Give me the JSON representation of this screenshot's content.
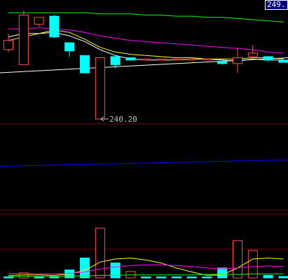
{
  "price_badge": "249.",
  "chart_data": [
    {
      "type": "candlestick",
      "panel": "main",
      "low_marker_label": "240.20",
      "colors": {
        "up": "#ff5050",
        "down": "#00ffff",
        "ma5": "#ffffff",
        "ma10": "#ffff00",
        "ma20": "#ff00ff",
        "ma60": "#00ff00",
        "trend": "#ffffff"
      },
      "candles": [
        {
          "open": 246.2,
          "close": 247.0,
          "high": 247.6,
          "low": 246.0
        },
        {
          "open": 244.9,
          "close": 249.2,
          "high": 249.6,
          "low": 244.9
        },
        {
          "open": 248.4,
          "close": 249.0,
          "high": 249.0,
          "low": 248.2
        },
        {
          "open": 249.1,
          "close": 247.3,
          "high": 249.2,
          "low": 247.2
        },
        {
          "open": 246.8,
          "close": 246.1,
          "high": 246.6,
          "low": 245.6
        },
        {
          "open": 245.7,
          "close": 244.2,
          "high": 245.7,
          "low": 244.2
        },
        {
          "open": 240.2,
          "close": 245.5,
          "high": 245.5,
          "low": 240.2
        },
        {
          "open": 245.6,
          "close": 244.9,
          "high": 245.6,
          "low": 244.6
        },
        {
          "open": 245.5,
          "close": 245.3,
          "high": 245.5,
          "low": 245.3
        },
        {
          "open": 245.4,
          "close": 245.4,
          "high": 245.4,
          "low": 245.4
        },
        {
          "open": 245.4,
          "close": 245.4,
          "high": 245.4,
          "low": 245.4
        },
        {
          "open": 245.4,
          "close": 245.4,
          "high": 245.4,
          "low": 245.4
        },
        {
          "open": 245.4,
          "close": 245.4,
          "high": 245.4,
          "low": 245.4
        },
        {
          "open": 245.4,
          "close": 245.4,
          "high": 245.4,
          "low": 245.4
        },
        {
          "open": 245.2,
          "close": 245.0,
          "high": 245.3,
          "low": 244.9
        },
        {
          "open": 245.0,
          "close": 245.5,
          "high": 246.4,
          "low": 244.2
        },
        {
          "open": 245.6,
          "close": 245.9,
          "high": 246.6,
          "low": 245.6
        },
        {
          "open": 245.6,
          "close": 245.3,
          "high": 245.6,
          "low": 245.2
        },
        {
          "open": 245.3,
          "close": 245.1,
          "high": 245.3,
          "low": 245.1
        }
      ],
      "ma_lines": [
        {
          "color": "#ffffff",
          "values": [
            247.3,
            247.6,
            247.6,
            247.7,
            247.4,
            246.9,
            246.2,
            245.7,
            245.4,
            245.3,
            245.3,
            245.3,
            245.4,
            245.4,
            245.3,
            245.2,
            245.4,
            245.3,
            245.3
          ]
        },
        {
          "color": "#ffff00",
          "values": [
            247.0,
            247.3,
            247.6,
            247.9,
            247.7,
            247.1,
            246.4,
            246.0,
            245.8,
            245.7,
            245.6,
            245.5,
            245.5,
            245.4,
            245.4,
            245.4,
            245.5,
            245.5,
            245.4
          ]
        },
        {
          "color": "#ff00ff",
          "values": [
            248.0,
            248.0,
            248.1,
            248.0,
            247.9,
            247.7,
            247.4,
            247.2,
            247.0,
            246.9,
            246.8,
            246.7,
            246.6,
            246.5,
            246.4,
            246.3,
            246.2,
            246.0,
            245.9
          ]
        },
        {
          "color": "#00ff00",
          "values": [
            249.4,
            249.4,
            249.4,
            249.4,
            249.4,
            249.4,
            249.3,
            249.3,
            249.3,
            249.2,
            249.2,
            249.1,
            249.1,
            249.0,
            249.0,
            248.9,
            248.8,
            248.7,
            248.6
          ]
        }
      ],
      "trend_line": {
        "start": 244.2,
        "end": 245.5
      }
    },
    {
      "type": "line",
      "panel": "middle",
      "color": "#0000ff",
      "values": [
        1.0,
        1.01,
        1.02,
        1.03,
        1.04,
        1.05,
        1.06,
        1.07,
        1.08,
        1.09,
        1.1,
        1.11,
        1.12,
        1.13,
        1.14,
        1.15,
        1.16,
        1.17,
        1.18
      ]
    },
    {
      "type": "volume",
      "panel": "bottom",
      "bars": [
        {
          "value": 2,
          "dir": "down"
        },
        {
          "value": 10,
          "dir": "up"
        },
        {
          "value": 2,
          "dir": "down"
        },
        {
          "value": 3,
          "dir": "down"
        },
        {
          "value": 16,
          "dir": "down"
        },
        {
          "value": 40,
          "dir": "down"
        },
        {
          "value": 100,
          "dir": "up"
        },
        {
          "value": 30,
          "dir": "down"
        },
        {
          "value": 13,
          "dir": "up"
        },
        {
          "value": 2,
          "dir": "down"
        },
        {
          "value": 2,
          "dir": "down"
        },
        {
          "value": 2,
          "dir": "down"
        },
        {
          "value": 2,
          "dir": "down"
        },
        {
          "value": 2,
          "dir": "down"
        },
        {
          "value": 20,
          "dir": "down"
        },
        {
          "value": 75,
          "dir": "up"
        },
        {
          "value": 55,
          "dir": "up"
        },
        {
          "value": 5,
          "dir": "down"
        },
        {
          "value": 3,
          "dir": "down"
        }
      ],
      "ma_lines": [
        {
          "color": "#ffff00",
          "values": [
            5,
            6,
            6,
            5,
            8,
            15,
            32,
            38,
            40,
            36,
            30,
            20,
            12,
            5,
            6,
            20,
            38,
            40,
            38
          ]
        },
        {
          "color": "#ff00ff",
          "values": [
            9,
            9,
            8,
            8,
            9,
            12,
            18,
            22,
            25,
            26,
            26,
            25,
            23,
            20,
            18,
            20,
            23,
            24,
            23
          ]
        },
        {
          "color": "#00ff00",
          "values": [
            3,
            3,
            3,
            3,
            4,
            4,
            5,
            5,
            6,
            6,
            6,
            6,
            6,
            7,
            7,
            7,
            8,
            8,
            8
          ]
        }
      ]
    }
  ]
}
